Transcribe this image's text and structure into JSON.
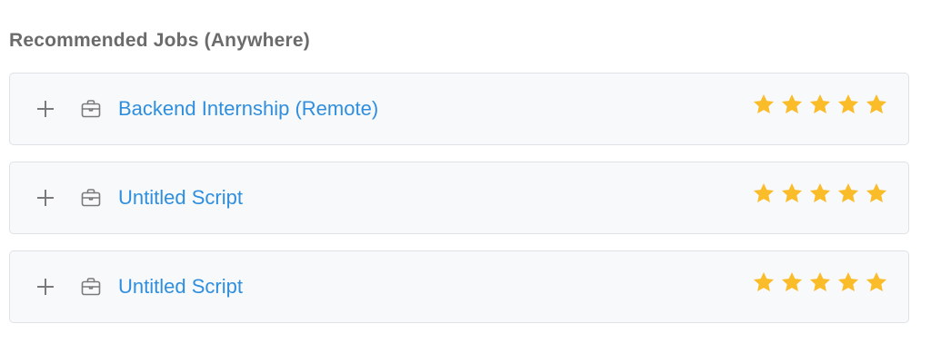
{
  "section": {
    "title": "Recommended Jobs (Anywhere)"
  },
  "colors": {
    "title_text": "#6b6b6b",
    "job_link": "#2f8fde",
    "card_background": "#f8f9fb",
    "card_border": "#dfe2e6",
    "star": "#fbbc2a",
    "icon": "#7a7a7a"
  },
  "icons": {
    "add": "plus-icon",
    "job": "briefcase-icon",
    "rating": "star-icon"
  },
  "jobs": [
    {
      "title": "Backend Internship (Remote)",
      "rating": 5,
      "rating_max": 5
    },
    {
      "title": "Untitled Script",
      "rating": 5,
      "rating_max": 5
    },
    {
      "title": "Untitled Script",
      "rating": 5,
      "rating_max": 5
    }
  ]
}
